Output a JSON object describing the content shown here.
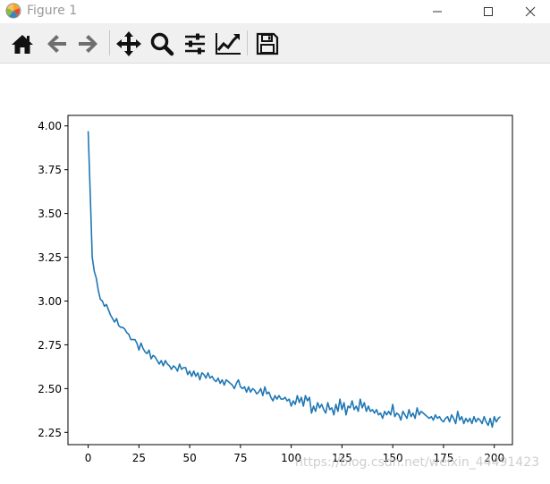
{
  "window": {
    "title": "Figure 1"
  },
  "toolbar": {
    "buttons": [
      {
        "name": "home",
        "icon": "home-icon"
      },
      {
        "name": "back",
        "icon": "arrow-left-icon"
      },
      {
        "name": "forward",
        "icon": "arrow-right-icon"
      },
      {
        "name": "pan",
        "icon": "move-icon"
      },
      {
        "name": "zoom",
        "icon": "magnifier-icon"
      },
      {
        "name": "configure-subplots",
        "icon": "sliders-icon"
      },
      {
        "name": "edit-axis",
        "icon": "line-chart-icon"
      },
      {
        "name": "save",
        "icon": "floppy-disk-icon"
      }
    ]
  },
  "colors": {
    "line": "#1f77b4",
    "toolbar_bg": "#f0f0f0",
    "disabled_icon": "#6e6e6e"
  },
  "chart_data": {
    "type": "line",
    "title": "",
    "xlabel": "",
    "ylabel": "",
    "xlim": [
      -9.95,
      208.95
    ],
    "ylim": [
      2.18,
      4.06
    ],
    "xticks": [
      0,
      25,
      50,
      75,
      100,
      125,
      150,
      175,
      200
    ],
    "yticks": [
      2.25,
      2.5,
      2.75,
      3.0,
      3.25,
      3.5,
      3.75,
      4.0
    ],
    "xtick_labels": [
      "0",
      "25",
      "50",
      "75",
      "100",
      "125",
      "150",
      "175",
      "200"
    ],
    "ytick_labels": [
      "2.25",
      "2.50",
      "2.75",
      "3.00",
      "3.25",
      "3.50",
      "3.75",
      "4.00"
    ],
    "grid": false,
    "series": [
      {
        "values": [
          3.97,
          3.62,
          3.25,
          3.17,
          3.13,
          3.06,
          3.01,
          3.0,
          2.97,
          2.98,
          2.95,
          2.92,
          2.9,
          2.88,
          2.9,
          2.86,
          2.85,
          2.85,
          2.84,
          2.82,
          2.81,
          2.78,
          2.78,
          2.78,
          2.76,
          2.72,
          2.76,
          2.73,
          2.71,
          2.7,
          2.72,
          2.67,
          2.69,
          2.68,
          2.66,
          2.64,
          2.66,
          2.63,
          2.66,
          2.64,
          2.63,
          2.61,
          2.63,
          2.62,
          2.6,
          2.64,
          2.61,
          2.62,
          2.62,
          2.58,
          2.6,
          2.57,
          2.6,
          2.57,
          2.59,
          2.55,
          2.59,
          2.58,
          2.56,
          2.59,
          2.56,
          2.57,
          2.55,
          2.54,
          2.56,
          2.53,
          2.55,
          2.52,
          2.55,
          2.54,
          2.53,
          2.52,
          2.5,
          2.53,
          2.55,
          2.51,
          2.5,
          2.51,
          2.48,
          2.51,
          2.48,
          2.5,
          2.49,
          2.47,
          2.48,
          2.5,
          2.46,
          2.51,
          2.47,
          2.48,
          2.45,
          2.43,
          2.46,
          2.44,
          2.46,
          2.44,
          2.44,
          2.45,
          2.43,
          2.44,
          2.4,
          2.43,
          2.41,
          2.46,
          2.42,
          2.45,
          2.4,
          2.46,
          2.43,
          2.45,
          2.36,
          2.4,
          2.37,
          2.42,
          2.39,
          2.41,
          2.38,
          2.36,
          2.42,
          2.38,
          2.39,
          2.35,
          2.41,
          2.37,
          2.44,
          2.38,
          2.42,
          2.35,
          2.4,
          2.39,
          2.43,
          2.38,
          2.4,
          2.37,
          2.44,
          2.39,
          2.42,
          2.37,
          2.4,
          2.37,
          2.38,
          2.36,
          2.38,
          2.35,
          2.36,
          2.33,
          2.37,
          2.35,
          2.37,
          2.35,
          2.41,
          2.34,
          2.36,
          2.35,
          2.32,
          2.37,
          2.35,
          2.33,
          2.38,
          2.34,
          2.36,
          2.33,
          2.39,
          2.35,
          2.37,
          2.36,
          2.35,
          2.34,
          2.33,
          2.34,
          2.32,
          2.35,
          2.33,
          2.34,
          2.32,
          2.31,
          2.33,
          2.34,
          2.31,
          2.35,
          2.33,
          2.3,
          2.37,
          2.32,
          2.34,
          2.3,
          2.33,
          2.31,
          2.33,
          2.3,
          2.34,
          2.31,
          2.33,
          2.32,
          2.3,
          2.34,
          2.31,
          2.29,
          2.33,
          2.28,
          2.34,
          2.31,
          2.33,
          2.34
        ]
      }
    ]
  }
}
